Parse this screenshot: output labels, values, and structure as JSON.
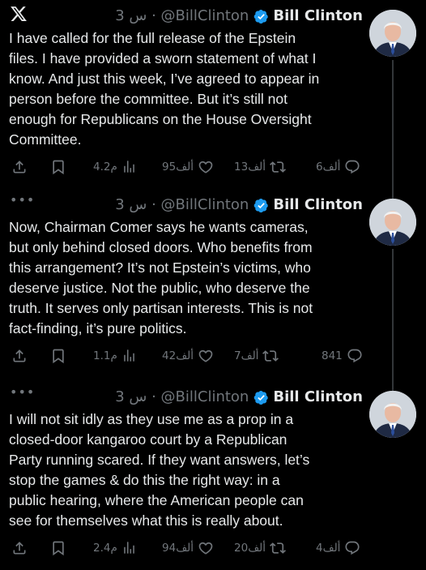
{
  "tweets": [
    {
      "display_name": "Bill Clinton",
      "handle_time": "3 س · @BillClinton",
      "lines": [
        "I have called for the full release of the Epstein",
        "files. I have provided a sworn statement of what I",
        "know. And just this week, I’ve agreed to appear in",
        "person before the committee. But it’s still not",
        "enough for Republicans on the House Oversight",
        "Committee."
      ],
      "replies": "6ألف",
      "reposts": "13ألف",
      "likes": "95ألف",
      "views": "4.2م"
    },
    {
      "display_name": "Bill Clinton",
      "handle_time": "3 س · @BillClinton",
      "lines": [
        "Now, Chairman Comer says he wants cameras,",
        "but only behind closed doors. Who benefits from",
        "this arrangement? It’s not Epstein’s victims, who",
        "deserve justice. Not the public, who deserve the",
        "truth. It serves only partisan interests. This is not",
        "fact-finding, it’s pure politics."
      ],
      "replies": "841",
      "reposts": "7ألف",
      "likes": "42ألف",
      "views": "1.1م"
    },
    {
      "display_name": "Bill Clinton",
      "handle_time": "3 س · @BillClinton",
      "lines": [
        "I will not sit idly as they use me as a prop in a",
        "closed-door kangaroo court by a Republican",
        "Party running scared. If they want answers, let’s",
        "stop the games & do this the right way: in a",
        "public hearing, where the American people can",
        "see for themselves what this is really about."
      ],
      "replies": "4ألف",
      "reposts": "20ألف",
      "likes": "94ألف",
      "views": "2.4م"
    }
  ],
  "colors": {
    "background": "#000000",
    "text": "#e7e9ea",
    "muted": "#71767b",
    "verified": "#1d9bf0",
    "thread_line": "#333639"
  },
  "icons": {
    "top_first": "x-logo-icon",
    "top_other": "more-dots-icon",
    "verified": "verified-badge-icon",
    "reply": "reply-icon",
    "repost": "repost-icon",
    "like": "heart-icon",
    "views": "views-icon",
    "bookmark": "bookmark-icon",
    "share": "share-icon"
  },
  "more_glyph": "•••"
}
